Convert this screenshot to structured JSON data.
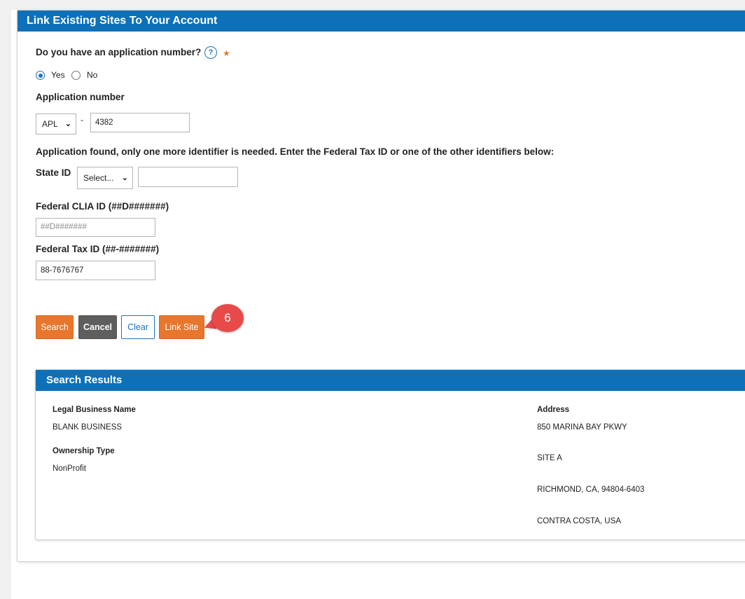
{
  "header": {
    "title": "Link Existing Sites To Your Account"
  },
  "app_question": {
    "label": "Do you have an application number?",
    "help_icon": "?",
    "required_marker": "★"
  },
  "radio": {
    "yes_label": "Yes",
    "no_label": "No",
    "selected": "Yes"
  },
  "application": {
    "label": "Application number",
    "prefix": "APL",
    "separator": "-",
    "number": "4382"
  },
  "found_message": "Application found, only one more identifier is needed. Enter the Federal Tax ID or one of the other identifiers below:",
  "state_id": {
    "label": "State ID",
    "select_value": "Select...",
    "value": ""
  },
  "clia": {
    "label": "Federal CLIA ID (##D#######)",
    "placeholder": "##D#######"
  },
  "tax": {
    "label": "Federal Tax ID (##-#######)",
    "value": "88-7676767"
  },
  "buttons": {
    "search": "Search",
    "cancel": "Cancel",
    "clear": "Clear",
    "link": "Link Site"
  },
  "callout": "6",
  "results": {
    "title": "Search Results",
    "business_label": "Legal Business Name",
    "business_value": "BLANK BUSINESS",
    "ownership_label": "Ownership Type",
    "ownership_value": "NonProfit",
    "address_label": "Address",
    "address_lines": [
      "850 MARINA BAY PKWY",
      "SITE A",
      "RICHMOND, CA, 94804-6403",
      "CONTRA COSTA, USA"
    ]
  },
  "colors": {
    "header_blue": "#0e70b8",
    "accent_orange": "#e8762c",
    "callout_red": "#e84a4a"
  }
}
